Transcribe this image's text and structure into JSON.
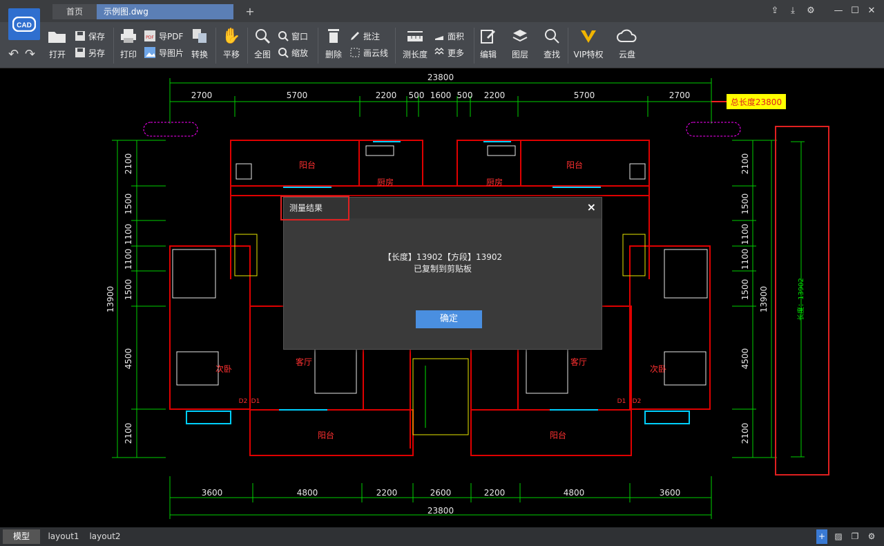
{
  "titlebar": {
    "tabs": [
      "首页",
      "示例图.dwg"
    ],
    "add_tab": "+"
  },
  "toolbar": {
    "open": "打开",
    "save": "保存",
    "saveas": "另存",
    "print": "打印",
    "export_pdf": "导PDF",
    "export_image": "导图片",
    "convert": "转换",
    "pan": "平移",
    "full": "全图",
    "window": "窗口",
    "zoom": "缩放",
    "delete": "删除",
    "annotate": "批注",
    "cloud_line": "画云线",
    "measure_length": "测长度",
    "area": "面积",
    "more": "更多",
    "edit": "编辑",
    "layers": "图层",
    "find": "查找",
    "vip": "VIP特权",
    "cloud_disk": "云盘"
  },
  "drawing": {
    "total_width": "23800",
    "top_dims": [
      "2700",
      "5700",
      "2200",
      "500",
      "1600",
      "500",
      "2200",
      "5700",
      "2700"
    ],
    "bottom_dims": [
      "3600",
      "4800",
      "2200",
      "2600",
      "2200",
      "4800",
      "3600"
    ],
    "left_dims": [
      "2100",
      "1500",
      "1100",
      "1100",
      "1500",
      "4500",
      "2100"
    ],
    "right_dims": [
      "2100",
      "1500",
      "1100",
      "1100",
      "1500",
      "4500",
      "2100"
    ],
    "height_total": "13900",
    "total_length_note": "总长度23800",
    "measured_label": "长度：13902",
    "rooms": {
      "balcony": "阳台",
      "kitchen": "厨房",
      "bedroom": "次卧",
      "living": "客厅"
    },
    "doors": {
      "d1": "D1",
      "d2": "D2"
    }
  },
  "dialog": {
    "title": "测量结果",
    "message_line1": "【长度】13902【方段】13902",
    "message_line2": "已复制到剪贴板",
    "ok_label": "确定",
    "close_icon": "×"
  },
  "bottom_tabs": [
    "模型",
    "layout1",
    "layout2"
  ],
  "colors": {
    "accent": "#4a8fe0",
    "dim": "#00e000",
    "wall": "#e00000",
    "text_red": "#ff3030"
  }
}
